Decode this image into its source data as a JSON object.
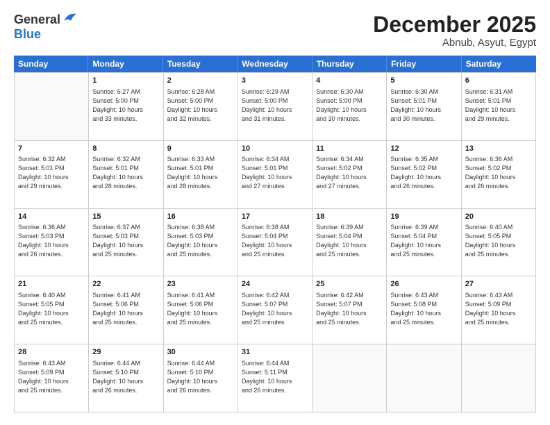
{
  "header": {
    "logo_general": "General",
    "logo_blue": "Blue",
    "month": "December 2025",
    "location": "Abnub, Asyut, Egypt"
  },
  "weekdays": [
    "Sunday",
    "Monday",
    "Tuesday",
    "Wednesday",
    "Thursday",
    "Friday",
    "Saturday"
  ],
  "weeks": [
    [
      {
        "day": "",
        "sunrise": "",
        "sunset": "",
        "daylight": "",
        "empty": true
      },
      {
        "day": "1",
        "sunrise": "Sunrise: 6:27 AM",
        "sunset": "Sunset: 5:00 PM",
        "daylight": "Daylight: 10 hours and 33 minutes."
      },
      {
        "day": "2",
        "sunrise": "Sunrise: 6:28 AM",
        "sunset": "Sunset: 5:00 PM",
        "daylight": "Daylight: 10 hours and 32 minutes."
      },
      {
        "day": "3",
        "sunrise": "Sunrise: 6:29 AM",
        "sunset": "Sunset: 5:00 PM",
        "daylight": "Daylight: 10 hours and 31 minutes."
      },
      {
        "day": "4",
        "sunrise": "Sunrise: 6:30 AM",
        "sunset": "Sunset: 5:00 PM",
        "daylight": "Daylight: 10 hours and 30 minutes."
      },
      {
        "day": "5",
        "sunrise": "Sunrise: 6:30 AM",
        "sunset": "Sunset: 5:01 PM",
        "daylight": "Daylight: 10 hours and 30 minutes."
      },
      {
        "day": "6",
        "sunrise": "Sunrise: 6:31 AM",
        "sunset": "Sunset: 5:01 PM",
        "daylight": "Daylight: 10 hours and 29 minutes."
      }
    ],
    [
      {
        "day": "7",
        "sunrise": "Sunrise: 6:32 AM",
        "sunset": "Sunset: 5:01 PM",
        "daylight": "Daylight: 10 hours and 29 minutes."
      },
      {
        "day": "8",
        "sunrise": "Sunrise: 6:32 AM",
        "sunset": "Sunset: 5:01 PM",
        "daylight": "Daylight: 10 hours and 28 minutes."
      },
      {
        "day": "9",
        "sunrise": "Sunrise: 6:33 AM",
        "sunset": "Sunset: 5:01 PM",
        "daylight": "Daylight: 10 hours and 28 minutes."
      },
      {
        "day": "10",
        "sunrise": "Sunrise: 6:34 AM",
        "sunset": "Sunset: 5:01 PM",
        "daylight": "Daylight: 10 hours and 27 minutes."
      },
      {
        "day": "11",
        "sunrise": "Sunrise: 6:34 AM",
        "sunset": "Sunset: 5:02 PM",
        "daylight": "Daylight: 10 hours and 27 minutes."
      },
      {
        "day": "12",
        "sunrise": "Sunrise: 6:35 AM",
        "sunset": "Sunset: 5:02 PM",
        "daylight": "Daylight: 10 hours and 26 minutes."
      },
      {
        "day": "13",
        "sunrise": "Sunrise: 6:36 AM",
        "sunset": "Sunset: 5:02 PM",
        "daylight": "Daylight: 10 hours and 26 minutes."
      }
    ],
    [
      {
        "day": "14",
        "sunrise": "Sunrise: 6:36 AM",
        "sunset": "Sunset: 5:03 PM",
        "daylight": "Daylight: 10 hours and 26 minutes."
      },
      {
        "day": "15",
        "sunrise": "Sunrise: 6:37 AM",
        "sunset": "Sunset: 5:03 PM",
        "daylight": "Daylight: 10 hours and 25 minutes."
      },
      {
        "day": "16",
        "sunrise": "Sunrise: 6:38 AM",
        "sunset": "Sunset: 5:03 PM",
        "daylight": "Daylight: 10 hours and 25 minutes."
      },
      {
        "day": "17",
        "sunrise": "Sunrise: 6:38 AM",
        "sunset": "Sunset: 5:04 PM",
        "daylight": "Daylight: 10 hours and 25 minutes."
      },
      {
        "day": "18",
        "sunrise": "Sunrise: 6:39 AM",
        "sunset": "Sunset: 5:04 PM",
        "daylight": "Daylight: 10 hours and 25 minutes."
      },
      {
        "day": "19",
        "sunrise": "Sunrise: 6:39 AM",
        "sunset": "Sunset: 5:04 PM",
        "daylight": "Daylight: 10 hours and 25 minutes."
      },
      {
        "day": "20",
        "sunrise": "Sunrise: 6:40 AM",
        "sunset": "Sunset: 5:05 PM",
        "daylight": "Daylight: 10 hours and 25 minutes."
      }
    ],
    [
      {
        "day": "21",
        "sunrise": "Sunrise: 6:40 AM",
        "sunset": "Sunset: 5:05 PM",
        "daylight": "Daylight: 10 hours and 25 minutes."
      },
      {
        "day": "22",
        "sunrise": "Sunrise: 6:41 AM",
        "sunset": "Sunset: 5:06 PM",
        "daylight": "Daylight: 10 hours and 25 minutes."
      },
      {
        "day": "23",
        "sunrise": "Sunrise: 6:41 AM",
        "sunset": "Sunset: 5:06 PM",
        "daylight": "Daylight: 10 hours and 25 minutes."
      },
      {
        "day": "24",
        "sunrise": "Sunrise: 6:42 AM",
        "sunset": "Sunset: 5:07 PM",
        "daylight": "Daylight: 10 hours and 25 minutes."
      },
      {
        "day": "25",
        "sunrise": "Sunrise: 6:42 AM",
        "sunset": "Sunset: 5:07 PM",
        "daylight": "Daylight: 10 hours and 25 minutes."
      },
      {
        "day": "26",
        "sunrise": "Sunrise: 6:43 AM",
        "sunset": "Sunset: 5:08 PM",
        "daylight": "Daylight: 10 hours and 25 minutes."
      },
      {
        "day": "27",
        "sunrise": "Sunrise: 6:43 AM",
        "sunset": "Sunset: 5:09 PM",
        "daylight": "Daylight: 10 hours and 25 minutes."
      }
    ],
    [
      {
        "day": "28",
        "sunrise": "Sunrise: 6:43 AM",
        "sunset": "Sunset: 5:09 PM",
        "daylight": "Daylight: 10 hours and 25 minutes."
      },
      {
        "day": "29",
        "sunrise": "Sunrise: 6:44 AM",
        "sunset": "Sunset: 5:10 PM",
        "daylight": "Daylight: 10 hours and 26 minutes."
      },
      {
        "day": "30",
        "sunrise": "Sunrise: 6:44 AM",
        "sunset": "Sunset: 5:10 PM",
        "daylight": "Daylight: 10 hours and 26 minutes."
      },
      {
        "day": "31",
        "sunrise": "Sunrise: 6:44 AM",
        "sunset": "Sunset: 5:11 PM",
        "daylight": "Daylight: 10 hours and 26 minutes."
      },
      {
        "day": "",
        "sunrise": "",
        "sunset": "",
        "daylight": "",
        "empty": true
      },
      {
        "day": "",
        "sunrise": "",
        "sunset": "",
        "daylight": "",
        "empty": true
      },
      {
        "day": "",
        "sunrise": "",
        "sunset": "",
        "daylight": "",
        "empty": true
      }
    ]
  ]
}
